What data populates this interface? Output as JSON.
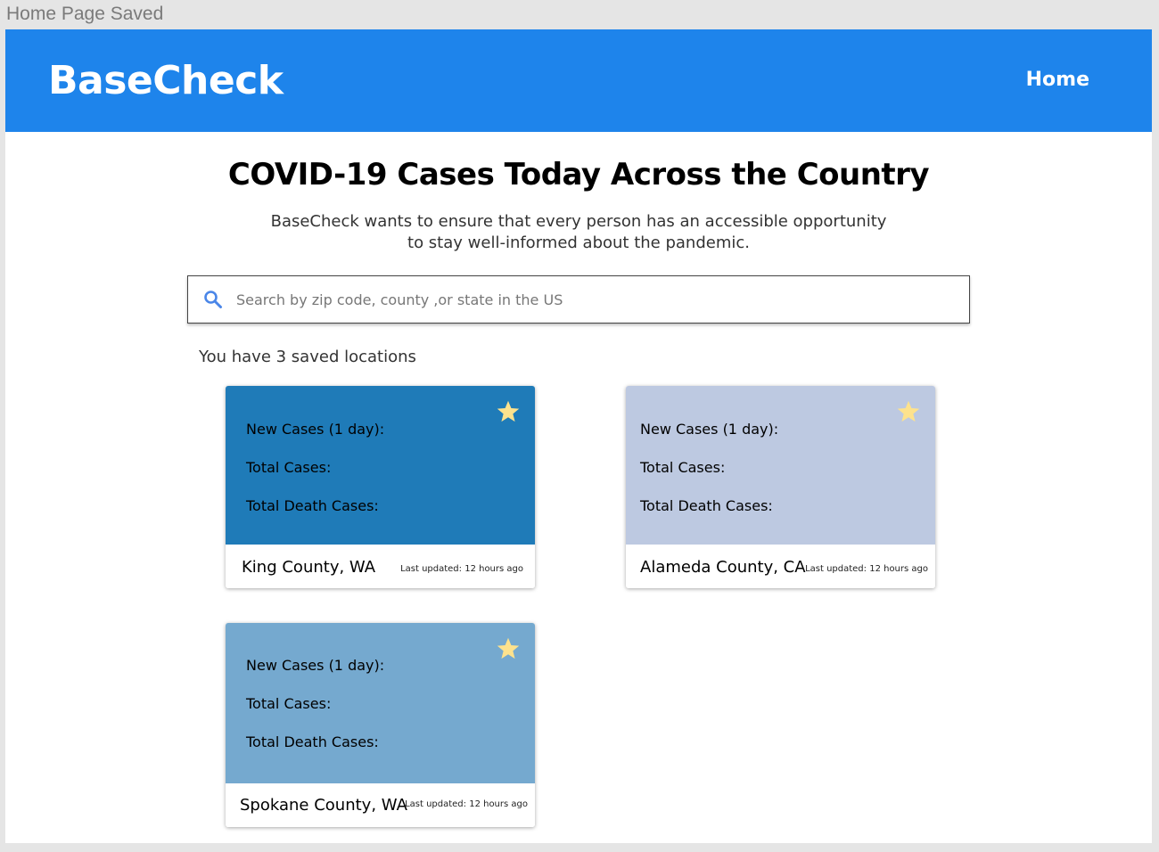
{
  "frame_label": "Home Page Saved",
  "header": {
    "brand": "BaseCheck",
    "nav_home": "Home"
  },
  "main": {
    "title": "COVID-19 Cases Today Across the Country",
    "subtitle": "BaseCheck wants to ensure that every person has an accessible opportunity to stay well-informed about the pandemic.",
    "search": {
      "placeholder": "Search by zip code, county ,or state in the US",
      "icon": "search-icon"
    },
    "saved_count": "You have 3 saved locations"
  },
  "cards": [
    {
      "location": "King County, WA",
      "new_cases_label": "New Cases (1 day):",
      "total_cases_label": "Total Cases:",
      "total_deaths_label": "Total Death Cases:",
      "updated": "Last updated: 12 hours ago",
      "color": "#1f7bb8",
      "icon": "star-icon"
    },
    {
      "location": "Alameda County, CA",
      "new_cases_label": "New Cases (1 day):",
      "total_cases_label": "Total Cases:",
      "total_deaths_label": "Total Death Cases:",
      "updated": "Last updated: 12 hours ago",
      "color": "#bdc9e1",
      "icon": "star-icon"
    },
    {
      "location": "Spokane County, WA",
      "new_cases_label": "New Cases (1 day):",
      "total_cases_label": "Total Cases:",
      "total_deaths_label": "Total Death Cases:",
      "updated": "Last updated: 12 hours ago",
      "color": "#75a9cf",
      "icon": "star-icon"
    }
  ],
  "colors": {
    "header": "#1e84eb",
    "star": "#fde28d"
  }
}
